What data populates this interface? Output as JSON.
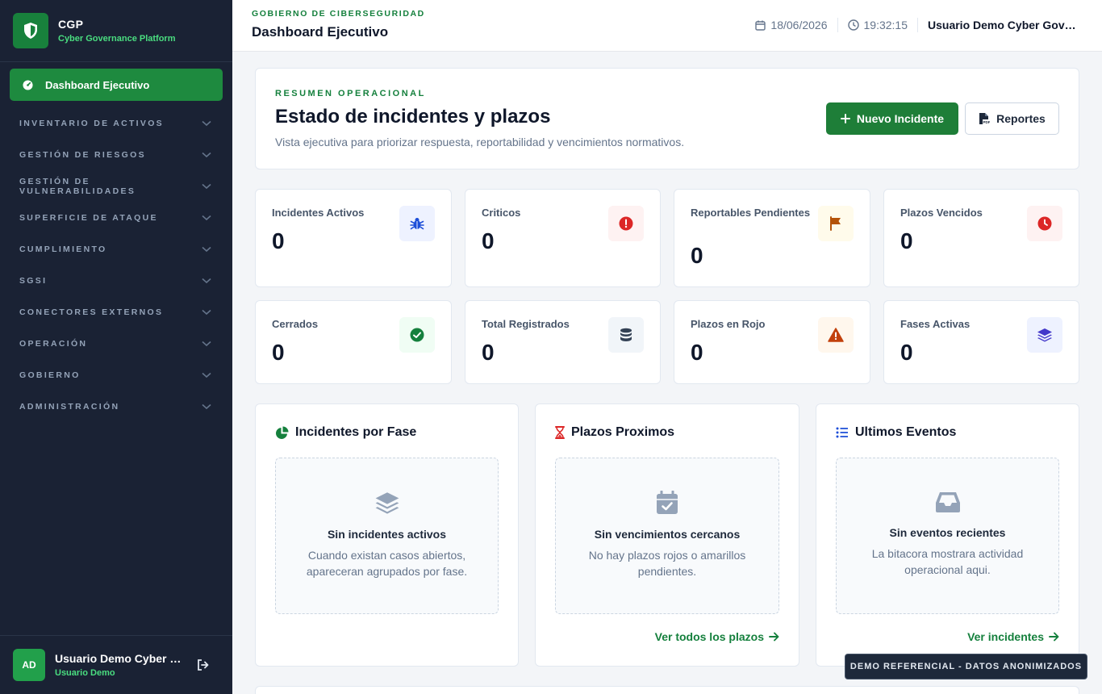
{
  "brand": {
    "name": "CGP",
    "subtitle": "Cyber Governance Platform"
  },
  "sidebar": {
    "active_item": "Dashboard Ejecutivo",
    "items": [
      "INVENTARIO DE ACTIVOS",
      "GESTIÓN DE RIESGOS",
      "GESTIÓN DE VULNERABILIDADES",
      "SUPERFICIE DE ATAQUE",
      "CUMPLIMIENTO",
      "SGSI",
      "CONECTORES EXTERNOS",
      "OPERACIÓN",
      "GOBIERNO",
      "ADMINISTRACIÓN"
    ],
    "user": {
      "initials": "AD",
      "name": "Usuario Demo Cyber Governance",
      "role": "Usuario Demo"
    }
  },
  "header": {
    "kicker": "GOBIERNO DE CIBERSEGURIDAD",
    "title": "Dashboard Ejecutivo",
    "date": "18/06/2026",
    "time": "19:32:15",
    "user": "Usuario Demo Cyber Governance"
  },
  "hero": {
    "kicker": "RESUMEN OPERACIONAL",
    "title": "Estado de incidentes y plazos",
    "description": "Vista ejecutiva para priorizar respuesta, reportabilidad y vencimientos normativos.",
    "primary_button": "Nuevo Incidente",
    "secondary_button": "Reportes"
  },
  "stats": [
    {
      "label": "Incidentes Activos",
      "value": "0",
      "icon": "bug-icon",
      "color": "#1d4ed8",
      "bg": "#eef2ff"
    },
    {
      "label": "Criticos",
      "value": "0",
      "icon": "alert-circle-icon",
      "color": "#dc2626",
      "bg": "#fef2f2"
    },
    {
      "label": "Reportables Pendientes",
      "value": "0",
      "icon": "flag-icon",
      "color": "#b45309",
      "bg": "#fffbeb"
    },
    {
      "label": "Plazos Vencidos",
      "value": "0",
      "icon": "clock-icon",
      "color": "#dc2626",
      "bg": "#fef2f2"
    },
    {
      "label": "Cerrados",
      "value": "0",
      "icon": "check-circle-icon",
      "color": "#15803d",
      "bg": "#f0fdf4"
    },
    {
      "label": "Total Registrados",
      "value": "0",
      "icon": "database-icon",
      "color": "#334155",
      "bg": "#f1f5f9"
    },
    {
      "label": "Plazos en Rojo",
      "value": "0",
      "icon": "warning-icon",
      "color": "#c2410c",
      "bg": "#fff7ed"
    },
    {
      "label": "Fases Activas",
      "value": "0",
      "icon": "layers-icon",
      "color": "#4338ca",
      "bg": "#eef2ff"
    }
  ],
  "panels": [
    {
      "title": "Incidentes por Fase",
      "icon": "pie-chart-icon",
      "empty_icon": "layers-icon",
      "empty_title": "Sin incidentes activos",
      "empty_desc": "Cuando existan casos abiertos, apareceran agrupados por fase.",
      "link": ""
    },
    {
      "title": "Plazos Proximos",
      "icon": "hourglass-icon",
      "empty_icon": "calendar-check-icon",
      "empty_title": "Sin vencimientos cercanos",
      "empty_desc": "No hay plazos rojos o amarillos pendientes.",
      "link": "Ver todos los plazos"
    },
    {
      "title": "Ultimos Eventos",
      "icon": "list-icon",
      "empty_icon": "inbox-icon",
      "empty_title": "Sin eventos recientes",
      "empty_desc": "La bitacora mostrara actividad operacional aqui.",
      "link": "Ver incidentes"
    }
  ],
  "demo_badge": "DEMO REFERENCIAL - DATOS ANONIMIZADOS"
}
